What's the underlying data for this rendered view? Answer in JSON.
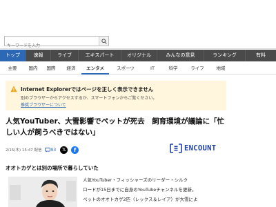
{
  "search": {
    "placeholder": "キーワードを入力"
  },
  "main_nav": [
    {
      "label": "トップ",
      "active": true
    },
    {
      "label": "速報"
    },
    {
      "label": "ライブ"
    },
    {
      "label": "エキスパート"
    },
    {
      "label": "オリジナル"
    },
    {
      "label": "みんなの意見"
    },
    {
      "label": "ランキング"
    },
    {
      "label": "有料"
    }
  ],
  "sub_nav": [
    {
      "label": "主要"
    },
    {
      "label": "国内"
    },
    {
      "label": "国際"
    },
    {
      "label": "経済"
    },
    {
      "label": "エンタメ",
      "active": true
    },
    {
      "label": "スポーツ"
    },
    {
      "label": "IT"
    },
    {
      "label": "科学"
    },
    {
      "label": "ライフ"
    },
    {
      "label": "地域"
    }
  ],
  "warning": {
    "title": "Internet Explorerではページを正しく表示できません",
    "body": "別のブラウザーからアクセスするか、スマートフォンからご覧ください。",
    "link": "推奨ブラウザーについて"
  },
  "article": {
    "headline": "人気YouTuber、大雪影響でペットが死去　飼育環境が議論に「忙しい人が飼うべきではない」",
    "date": "2/15(木) 15:47 配信",
    "comments": "93",
    "source_logo": "ENCOUNT",
    "subheading": "オオトカゲとは別の場所で暮らしていた",
    "body": [
      "人気YouTuber・フィッシャーズのリーダー・シルク",
      "ロードが15日までに自身のYouTubeチャンネルを更新。",
      "ペットのオオトカゲ2匹（レックス＆レイア）が大雪によ"
    ]
  },
  "colors": {
    "nav_bg": "#4a4a4a",
    "nav_active": "#2c68b3",
    "warning_bg": "#fff6dd",
    "link": "#2c68b3",
    "logo": "#1f3fa8"
  }
}
